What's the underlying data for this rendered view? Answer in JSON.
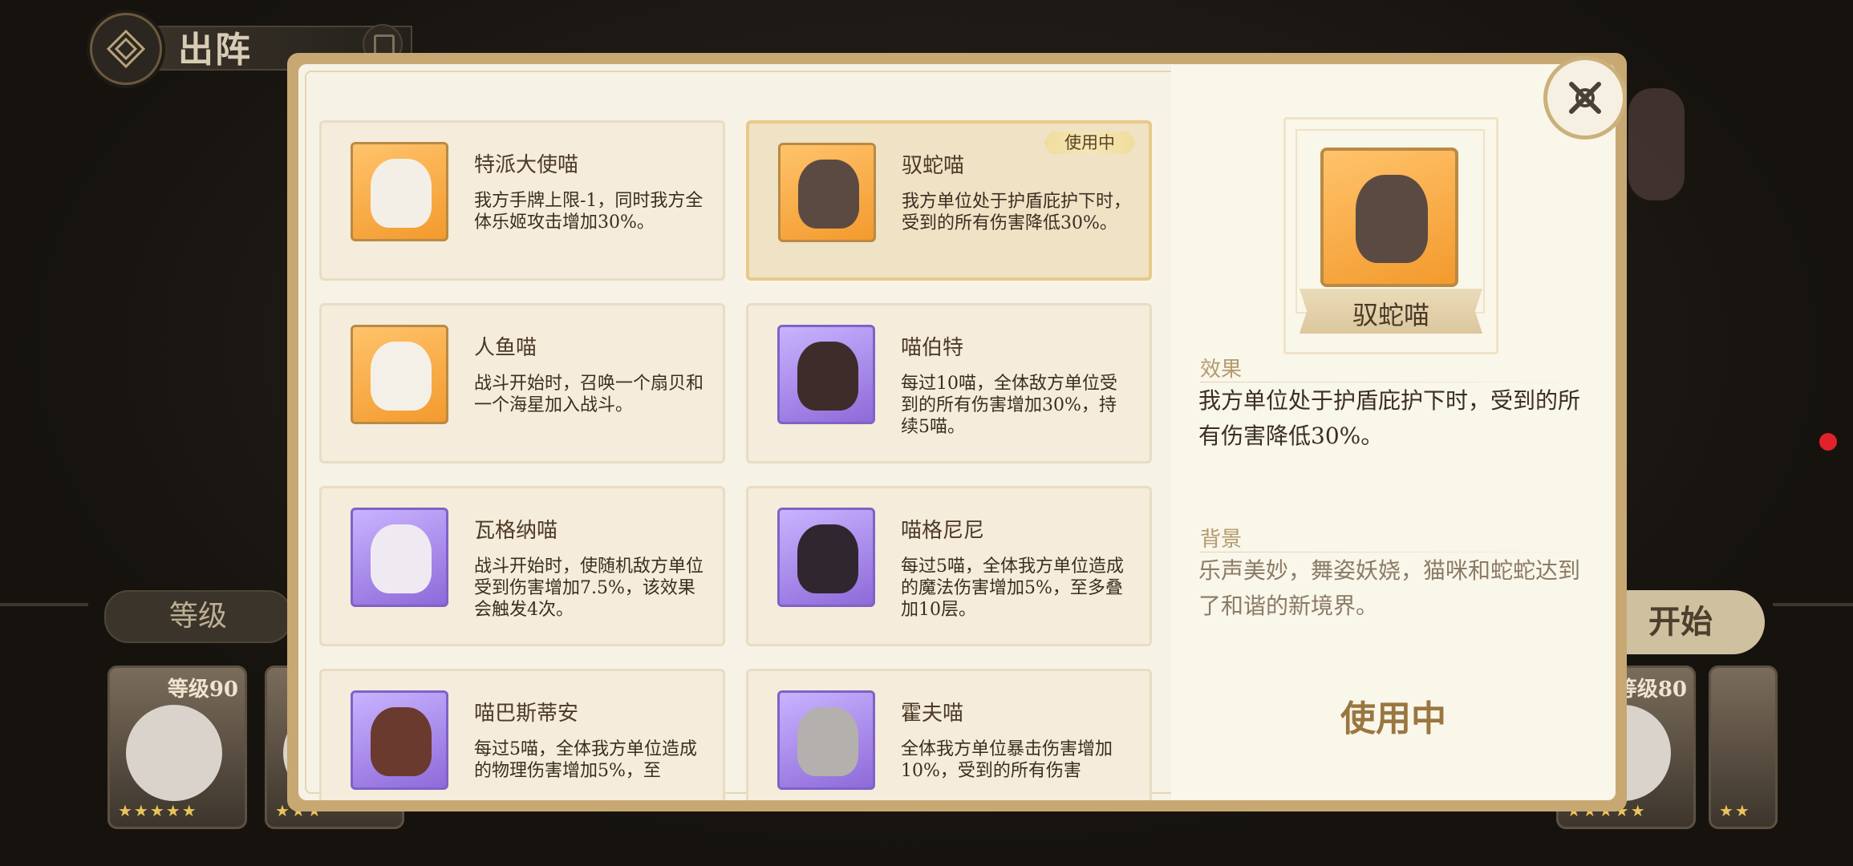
{
  "header": {
    "title": "出阵"
  },
  "background": {
    "level_tab": "等级",
    "start_button": "开始",
    "hero_cards": [
      {
        "level": "等级90",
        "stars": "★★★★★"
      },
      {
        "level": "",
        "stars": "★★★"
      },
      {
        "level": "等级80",
        "stars": "★★★★★"
      },
      {
        "level": "",
        "stars": "★★"
      }
    ]
  },
  "cats": [
    {
      "name": "特派大使喵",
      "desc": "我方手牌上限-1，同时我方全体乐姬攻击增加30%。",
      "rarity": "orange"
    },
    {
      "name": "驭蛇喵",
      "desc": "我方单位处于护盾庇护下时，受到的所有伤害降低30%。",
      "rarity": "orange",
      "badge": "使用中"
    },
    {
      "name": "人鱼喵",
      "desc": "战斗开始时，召唤一个扇贝和一个海星加入战斗。",
      "rarity": "orange"
    },
    {
      "name": "喵伯特",
      "desc": "每过10喵，全体敌方单位受到的所有伤害增加30%，持续5喵。",
      "rarity": "purple"
    },
    {
      "name": "瓦格纳喵",
      "desc": "战斗开始时，使随机敌方单位受到伤害增加7.5%，该效果会触发4次。",
      "rarity": "purple"
    },
    {
      "name": "喵格尼尼",
      "desc": "每过5喵，全体我方单位造成的魔法伤害增加5%，至多叠加10层。",
      "rarity": "purple"
    },
    {
      "name": "喵巴斯蒂安",
      "desc": "每过5喵，全体我方单位造成的物理伤害增加5%，至",
      "rarity": "purple"
    },
    {
      "name": "霍夫喵",
      "desc": "全体我方单位暴击伤害增加10%，受到的所有伤害",
      "rarity": "purple"
    }
  ],
  "detail": {
    "name": "驭蛇喵",
    "effect_label": "效果",
    "effect_text": "我方单位处于护盾庇护下时，受到的所有伤害降低30%。",
    "background_label": "背景",
    "background_text": "乐声美妙，舞姿妖娆，猫咪和蛇蛇达到了和谐的新境界。",
    "status": "使用中"
  },
  "colors": {
    "accent": "#9a7640",
    "frame": "#c8a872",
    "badge": "#f0dc9c"
  }
}
